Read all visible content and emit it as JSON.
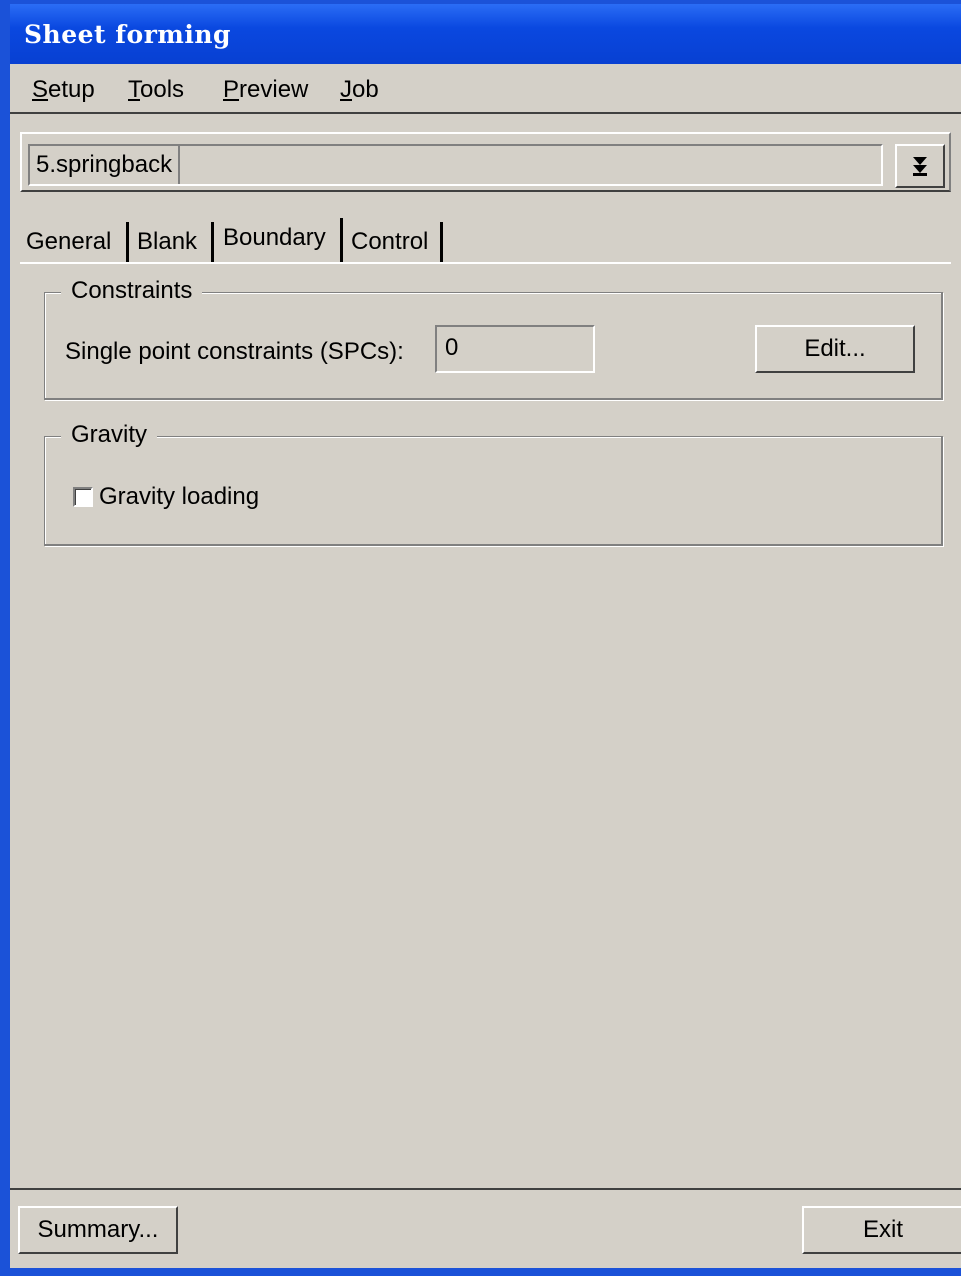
{
  "window": {
    "title": "Sheet forming"
  },
  "menu": [
    {
      "label": "Setup",
      "accel": "S",
      "rest": "etup"
    },
    {
      "label": "Tools",
      "accel": "T",
      "rest": "ools"
    },
    {
      "label": "Preview",
      "accel": "P",
      "rest": "review"
    },
    {
      "label": "Job",
      "accel": "J",
      "rest": "ob"
    }
  ],
  "step_selector": {
    "value": "5.springback",
    "dropdown_icon": "double-chevron-down-icon"
  },
  "tabs": [
    {
      "label": "General",
      "active": false
    },
    {
      "label": "Blank",
      "active": false
    },
    {
      "label": "Boundary",
      "active": true
    },
    {
      "label": "Control",
      "active": false
    }
  ],
  "constraints": {
    "title": "Constraints",
    "spc_label": "Single point constraints (SPCs):",
    "spc_value": "0",
    "edit_button": "Edit..."
  },
  "gravity": {
    "title": "Gravity",
    "checkbox_label": "Gravity loading",
    "checked": false
  },
  "footer": {
    "summary_button": "Summary...",
    "exit_button": "Exit"
  }
}
